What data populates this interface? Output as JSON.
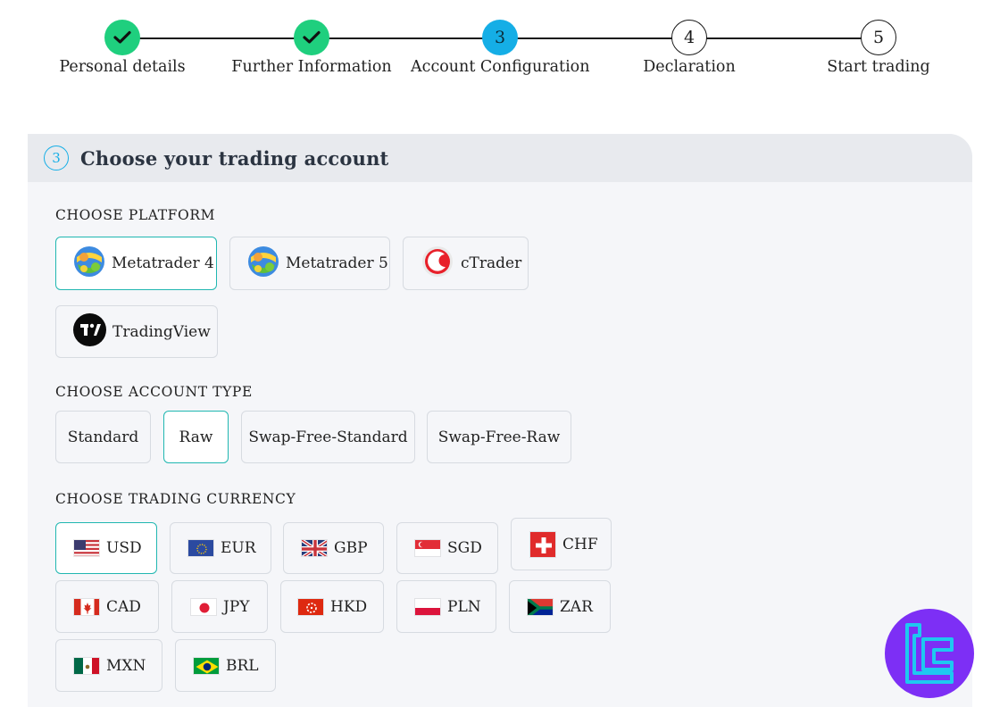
{
  "stepper": {
    "steps": [
      {
        "label": "Personal details",
        "number": "",
        "state": "done"
      },
      {
        "label": "Further Information",
        "number": "",
        "state": "done"
      },
      {
        "label": "Account Configuration",
        "number": "3",
        "state": "active"
      },
      {
        "label": "Declaration",
        "number": "4",
        "state": "todo"
      },
      {
        "label": "Start trading",
        "number": "5",
        "state": "todo"
      }
    ]
  },
  "panel": {
    "number": "3",
    "title": "Choose your trading account"
  },
  "platform": {
    "label": "CHOOSE PLATFORM",
    "options": [
      {
        "label": "Metatrader 4",
        "icon": "metatrader-icon",
        "selected": true
      },
      {
        "label": "Metatrader 5",
        "icon": "metatrader-icon",
        "selected": false
      },
      {
        "label": "cTrader",
        "icon": "ctrader-icon",
        "selected": false
      },
      {
        "label": "TradingView",
        "icon": "tradingview-icon",
        "selected": false
      }
    ]
  },
  "account_type": {
    "label": "CHOOSE ACCOUNT TYPE",
    "options": [
      {
        "label": "Standard",
        "selected": false
      },
      {
        "label": "Raw",
        "selected": true
      },
      {
        "label": "Swap-Free-Standard",
        "selected": false
      },
      {
        "label": "Swap-Free-Raw",
        "selected": false
      }
    ]
  },
  "currency": {
    "label": "CHOOSE TRADING CURRENCY",
    "options": [
      {
        "label": "USD",
        "flag": "us-flag-icon",
        "selected": true
      },
      {
        "label": "EUR",
        "flag": "eu-flag-icon",
        "selected": false
      },
      {
        "label": "GBP",
        "flag": "gb-flag-icon",
        "selected": false
      },
      {
        "label": "SGD",
        "flag": "sg-flag-icon",
        "selected": false
      },
      {
        "label": "CHF",
        "flag": "ch-flag-icon",
        "selected": false
      },
      {
        "label": "CAD",
        "flag": "ca-flag-icon",
        "selected": false
      },
      {
        "label": "JPY",
        "flag": "jp-flag-icon",
        "selected": false
      },
      {
        "label": "HKD",
        "flag": "hk-flag-icon",
        "selected": false
      },
      {
        "label": "PLN",
        "flag": "pl-flag-icon",
        "selected": false
      },
      {
        "label": "ZAR",
        "flag": "za-flag-icon",
        "selected": false
      },
      {
        "label": "MXN",
        "flag": "mx-flag-icon",
        "selected": false
      },
      {
        "label": "BRL",
        "flag": "br-flag-icon",
        "selected": false
      }
    ]
  },
  "colors": {
    "done": "#1fcf7e",
    "active": "#15aee6",
    "selected_border": "#20b7b1",
    "badge": "#7d2ff5"
  }
}
